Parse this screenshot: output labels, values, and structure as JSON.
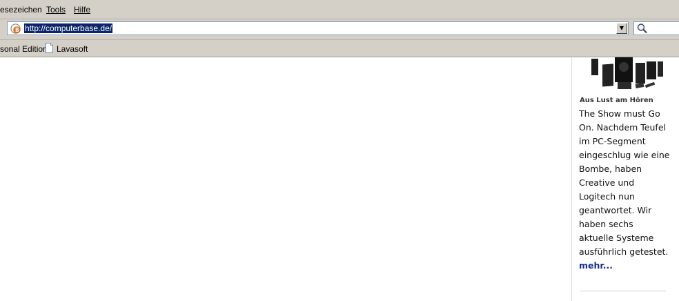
{
  "menu": {
    "bookmarks": "esezeichen",
    "tools": "Tools",
    "help": "Hilfe"
  },
  "navbar": {
    "url": "http://computerbase.de/",
    "site_icon": "computerbase-favicon",
    "dropdown_icon": "chevron-down-icon",
    "search_icon": "search-icon"
  },
  "bookmarks_bar": {
    "items": [
      {
        "label": "sonal Edition"
      },
      {
        "label": "Lavasoft",
        "icon": "page-icon"
      }
    ]
  },
  "sidebar": {
    "image": "speaker-system-image",
    "heading": "Aus Lust am Hören",
    "text": "The Show must Go On. Nachdem Teufel im PC-Segment eingeschlug wie eine Bombe, haben Creative und Logitech nun geantwortet. Wir haben sechs aktuelle Systeme ausführlich getestet.",
    "more_link": "mehr..."
  },
  "colors": {
    "chrome": "#d4d0c8",
    "selection": "#0a246a",
    "link": "#1a2d8f"
  }
}
